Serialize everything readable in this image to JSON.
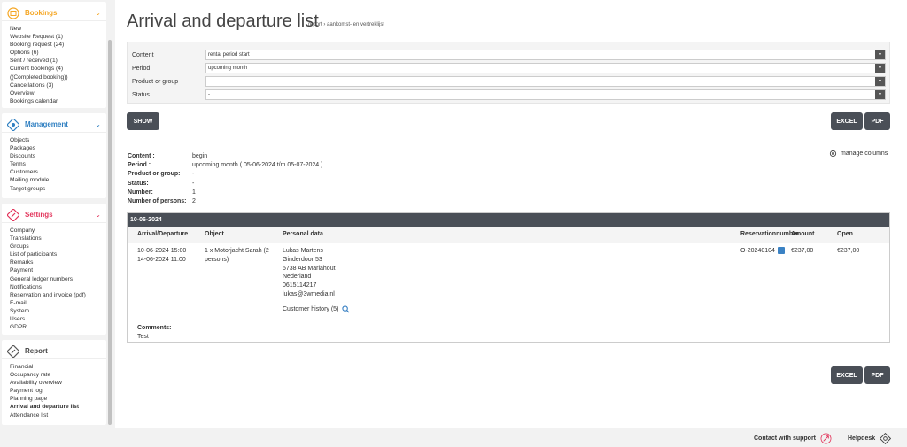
{
  "sidebar": {
    "bookings": {
      "title": "Bookings",
      "items": [
        "New",
        "Website Request (1)",
        "Booking request (24)",
        "Options (6)",
        "Sent / received (1)",
        "Current bookings (4)",
        "((Completed booking))",
        "Cancellations (3)",
        "Overview",
        "Bookings calendar"
      ]
    },
    "management": {
      "title": "Management",
      "items": [
        "Objects",
        "Packages",
        "Discounts",
        "Terms",
        "Customers",
        "Mailing module",
        "Target groups"
      ]
    },
    "settings": {
      "title": "Settings",
      "items": [
        "Company",
        "Translations",
        "Groups",
        "List of participants",
        "Remarks",
        "Payment",
        "General ledger numbers",
        "Notifications",
        "Reservation and invoice (pdf)",
        "E-mail",
        "System",
        "Users",
        "GDPR"
      ]
    },
    "report": {
      "title": "Report",
      "items": [
        "Financial",
        "Occupancy rate",
        "Availability overview",
        "Payment log",
        "Planning page",
        "Arrival and departure list",
        "Attendance list"
      ],
      "active": "Arrival and departure list"
    }
  },
  "colors": {
    "bookings": "#f5a623",
    "management": "#2f7fc1",
    "settings": "#e2335a",
    "report": "#555555",
    "button": "#4a4f57"
  },
  "page": {
    "title": "Arrival and departure list",
    "breadcrumb": "report › aankomst- en vertreklijst"
  },
  "filters": [
    {
      "label": "Content",
      "value": "rental period start"
    },
    {
      "label": "Period",
      "value": "upcoming month"
    },
    {
      "label": "Product or group",
      "value": "-"
    },
    {
      "label": "Status",
      "value": "-"
    }
  ],
  "buttons": {
    "show": "SHOW",
    "excel": "EXCEL",
    "pdf": "PDF"
  },
  "manage_columns": "manage columns",
  "summary": [
    {
      "label": "Content :",
      "value": "begin"
    },
    {
      "label": "Period :",
      "value": "upcoming month ( 05-06-2024 t/m 05-07-2024 )"
    },
    {
      "label": "Product or group:",
      "value": "-"
    },
    {
      "label": "Status:",
      "value": "-"
    },
    {
      "label": "Number:",
      "value": "1"
    },
    {
      "label": "Number of persons:",
      "value": "2"
    }
  ],
  "table": {
    "group_date": "10-06-2024",
    "columns": {
      "arrival": "Arrival/Departure",
      "object": "Object",
      "personal": "Personal data",
      "reservation": "Reservationnumber",
      "amount": "Amount",
      "open": "Open"
    },
    "row": {
      "arrival": "10-06-2024 15:00",
      "departure": "14-06-2024 11:00",
      "object_line1": "1 x Motorjacht Sarah (2",
      "object_line2": "persons)",
      "name": "Lukas Martens",
      "street": "Ginderdoor 53",
      "city": "5738 AB Mariahout",
      "country": "Nederland",
      "phone": "0615114217",
      "email": "lukas@3wmedia.nl",
      "customer_history": "Customer history (5)",
      "reservation": "O-20240104",
      "amount": "€237,00",
      "open": "€237,00",
      "comments_label": "Comments:",
      "comments": "Test"
    }
  },
  "footer": {
    "support": "Contact with support",
    "helpdesk": "Helpdesk"
  }
}
